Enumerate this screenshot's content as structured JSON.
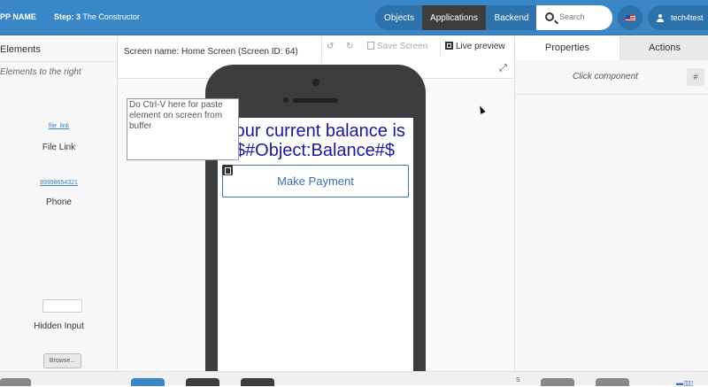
{
  "header": {
    "app_name": "PP NAME",
    "step_label": "Step: 3",
    "step_title": "The Constructor",
    "nav": [
      "Objects",
      "Applications",
      "Backend"
    ],
    "active_nav": "Applications",
    "search_placeholder": "Search",
    "language_icon": "us-flag-icon",
    "username": "tech4test",
    "colors": {
      "bar": "#3a87c8",
      "active_tab": "#3d3d3d"
    }
  },
  "left_panel": {
    "title": "Elements",
    "subtitle": "Elements to the right",
    "items": [
      {
        "preview": "file_link",
        "label": "File Link"
      },
      {
        "preview": "89998654321",
        "label": "Phone"
      },
      {
        "preview": "",
        "label": "Hidden Input"
      },
      {
        "preview": "Browse...",
        "label": ""
      }
    ]
  },
  "toolbar": {
    "screen_name": "Screen name: Home Screen (Screen ID: 64)",
    "undo_icon": "undo-icon",
    "redo_icon": "redo-icon",
    "save_label": "Save Screen",
    "live_preview_label": "Live preview",
    "expand_icon": "expand-icon"
  },
  "canvas": {
    "paste_hint": "Do Ctrl-V here for paste element on screen from buffer",
    "balance_text": "Your current balance is $#Object:Balance#$",
    "button_label": "Make Payment",
    "colors": {
      "text": "#1a17a8",
      "button": "#3a6fba"
    }
  },
  "right_panel": {
    "tabs": [
      "Properties",
      "Actions"
    ],
    "active_tab": "Properties",
    "empty_hint": "Click component",
    "hash_label": "#"
  },
  "bottom": {
    "letter": "S"
  }
}
